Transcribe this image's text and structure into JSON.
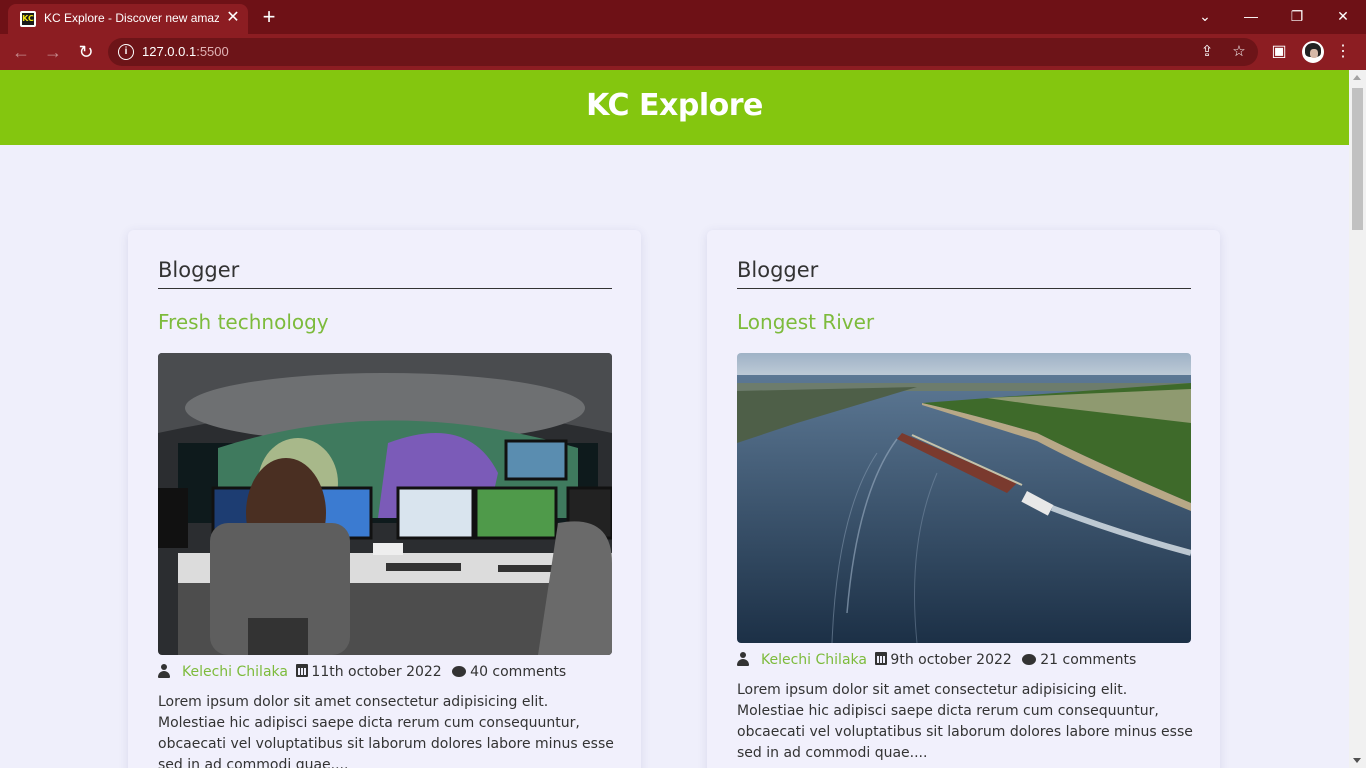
{
  "browser": {
    "tab_title": "KC Explore - Discover new amazing",
    "favicon_text": "KC",
    "url_host": "127.0.0.1",
    "url_port": ":5500"
  },
  "site": {
    "title": "KC Explore"
  },
  "posts": [
    {
      "category": "Blogger",
      "title": "Fresh technology",
      "image_desc": "control-room",
      "author": "Kelechi Chilaka",
      "date": "11th october 2022",
      "comments": "40 comments",
      "excerpt": "Lorem ipsum dolor sit amet consectetur adipisicing elit. Molestiae hic adipisci saepe dicta rerum cum consequuntur, obcaecati vel voluptatibus sit laborum dolores labore minus esse sed in ad commodi quae...."
    },
    {
      "category": "Blogger",
      "title": "Longest River",
      "image_desc": "river-barge",
      "author": "Kelechi Chilaka",
      "date": "9th october 2022",
      "comments": "21 comments",
      "excerpt": "Lorem ipsum dolor sit amet consectetur adipisicing elit. Molestiae hic adipisci saepe dicta rerum cum consequuntur, obcaecati vel voluptatibus sit laborum dolores labore minus esse sed in ad commodi quae...."
    }
  ]
}
